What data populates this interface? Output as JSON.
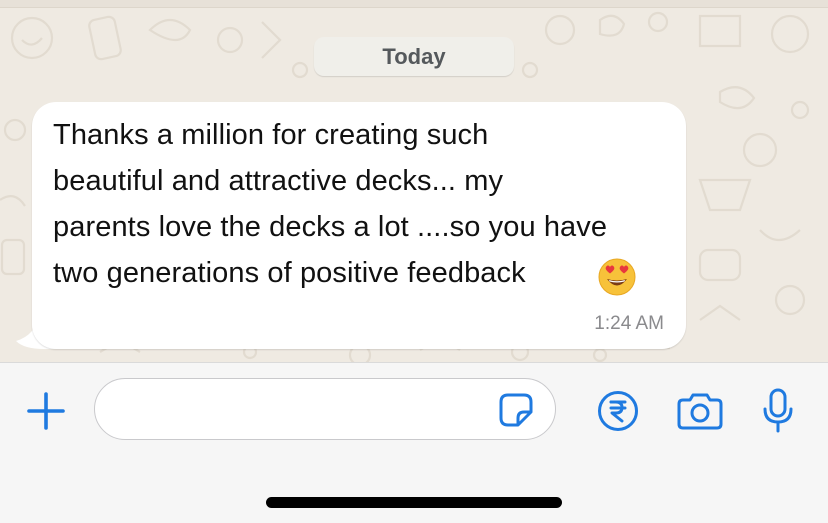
{
  "chat": {
    "date_label": "Today",
    "message": {
      "lines": [
        "Thanks a million for creating such",
        "beautiful and attractive decks... my",
        "parents love the decks a lot ....so you have",
        "two generations of positive feedback"
      ],
      "emoji": "heart-eyes-emoji",
      "time": "1:24 AM"
    }
  },
  "composer": {
    "input_value": "",
    "input_placeholder": "",
    "icons": [
      "plus-icon",
      "sticker-icon",
      "rupee-payment-icon",
      "camera-icon",
      "microphone-icon"
    ]
  },
  "colors": {
    "accent": "#1f7ae0",
    "chat_background": "#efeae2",
    "bubble": "#ffffff",
    "date_pill": "#f0efea",
    "input_bar": "#f6f6f6"
  }
}
